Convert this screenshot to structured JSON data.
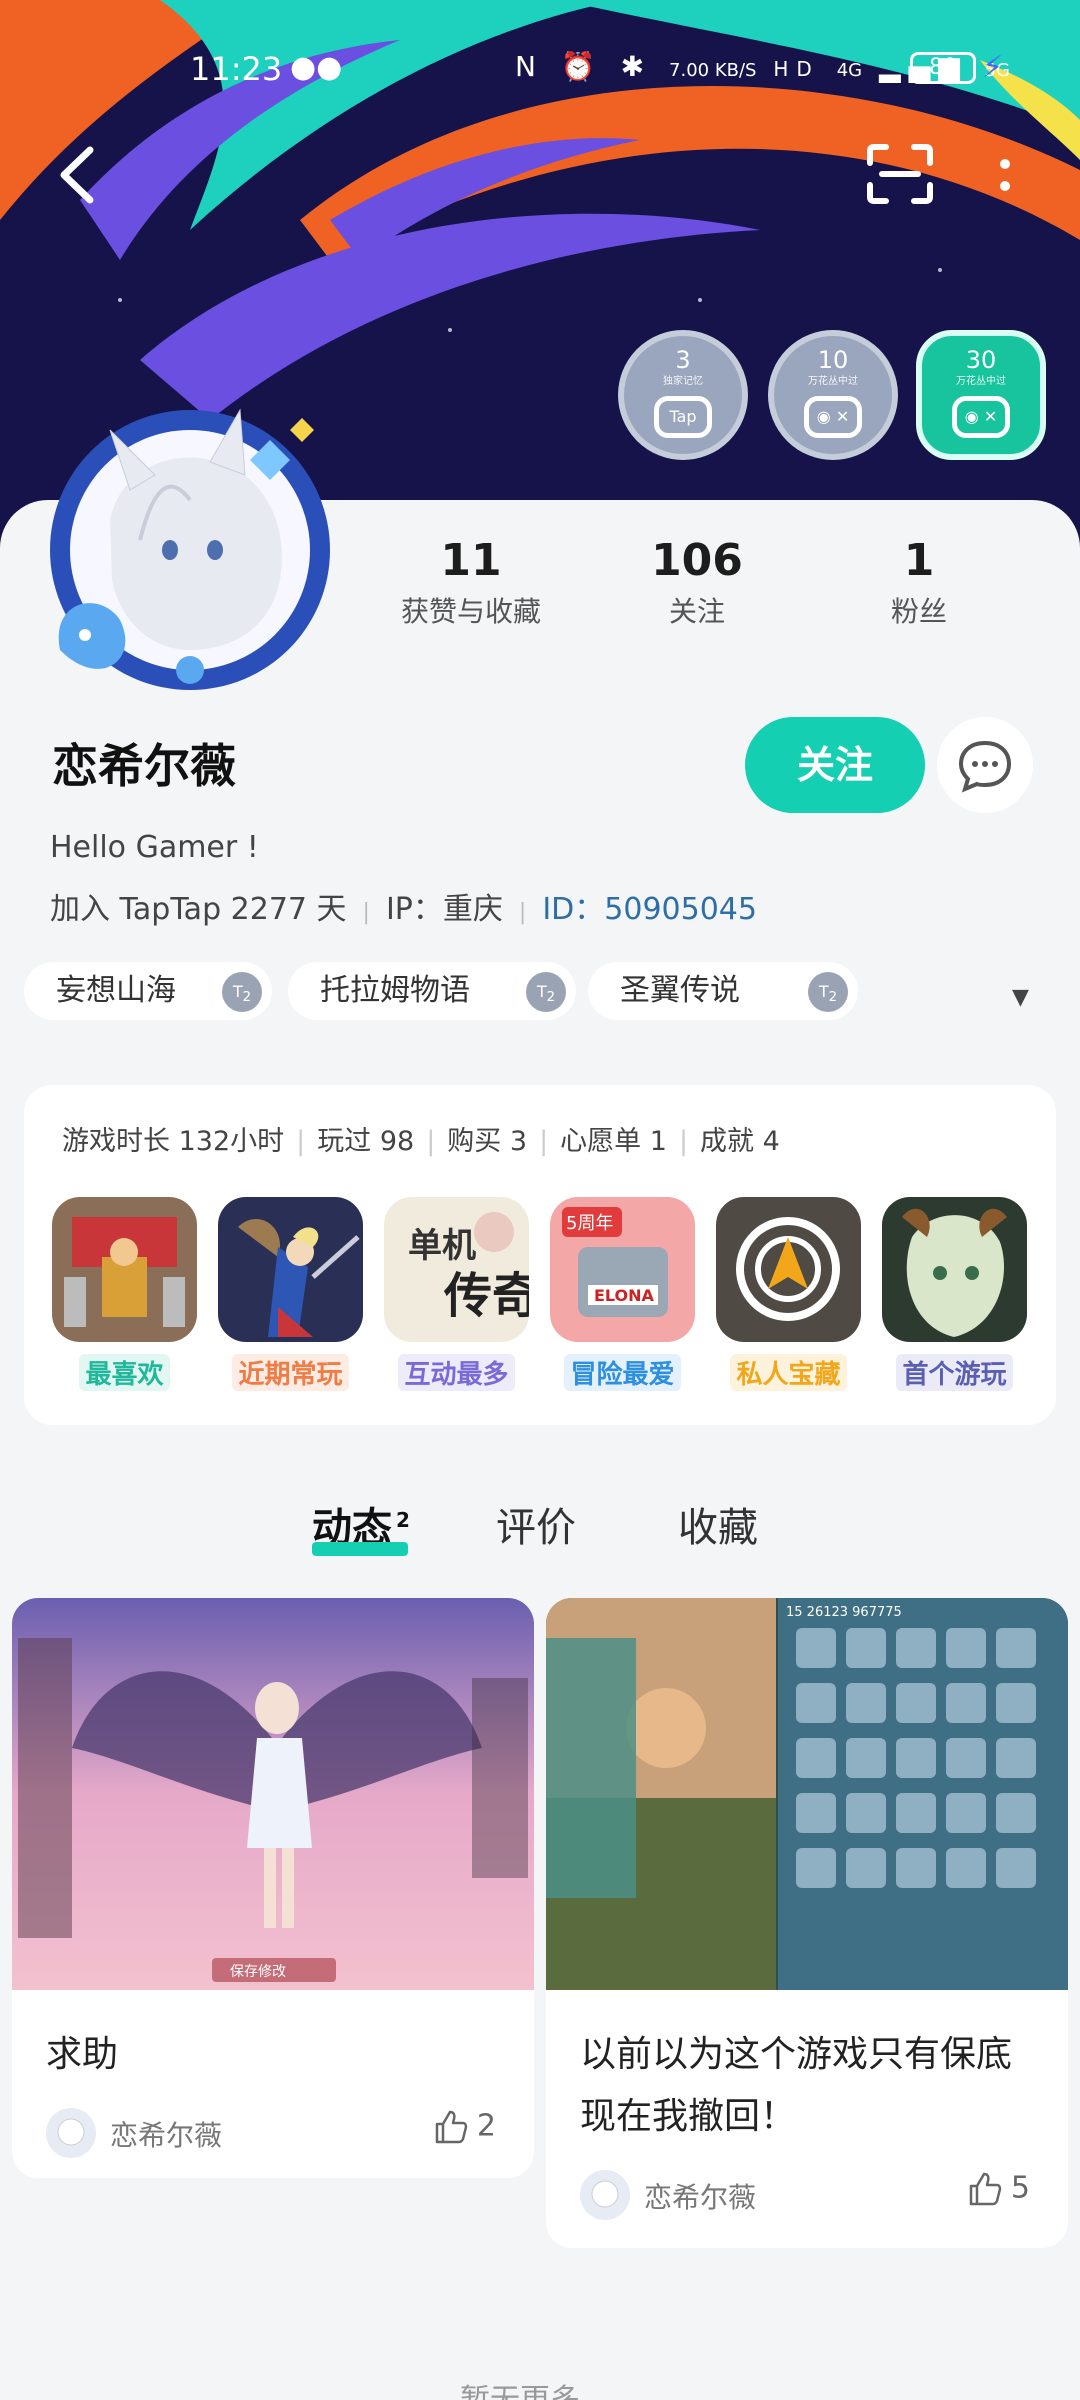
{
  "status_bar": {
    "time": "11:23",
    "net_speed": "7.00 KB/S",
    "signal_labels": [
      "4G",
      "5G"
    ],
    "hd": "HD",
    "battery": "80"
  },
  "badges": [
    {
      "num": "3",
      "caption": "独家记忆",
      "glyph": "Tap"
    },
    {
      "num": "10",
      "caption": "万花丛中过",
      "glyph": ""
    },
    {
      "num": "30",
      "caption": "万花丛中过",
      "glyph": ""
    }
  ],
  "stats": [
    {
      "value": "11",
      "label": "获赞与收藏"
    },
    {
      "value": "106",
      "label": "关注"
    },
    {
      "value": "1",
      "label": "粉丝"
    }
  ],
  "profile": {
    "name": "恋希尔薇",
    "follow_label": "关注",
    "bio": "Hello Gamer !",
    "joined": "加入 TapTap 2277 天",
    "ip": "IP：重庆",
    "id": "ID：50905045"
  },
  "tags": [
    {
      "name": "妄想山海",
      "level": "2"
    },
    {
      "name": "托拉姆物语",
      "level": "2"
    },
    {
      "name": "圣翼传说",
      "level": "2"
    }
  ],
  "game_stats": {
    "playtime": "游戏时长 132小时",
    "played": "玩过 98",
    "bought": "购买 3",
    "wishlist": "心愿单 1",
    "achievements": "成就 4"
  },
  "game_tiles": [
    {
      "label": "最喜欢",
      "color": "#1fb89a",
      "bg": "#e3f7f2"
    },
    {
      "label": "近期常玩",
      "color": "#f07b45",
      "bg": "#fdece3"
    },
    {
      "label": "互动最多",
      "color": "#7a6ad8",
      "bg": "#eeebfb"
    },
    {
      "label": "冒险最爱",
      "color": "#2d8fe0",
      "bg": "#e4f1fc"
    },
    {
      "label": "私人宝藏",
      "color": "#f2a71b",
      "bg": "#fdf3dd"
    },
    {
      "label": "首个游玩",
      "color": "#5b5fb3",
      "bg": "#ebebf7"
    }
  ],
  "game_tile_texts": {
    "t3a": "单机",
    "t3b": "传奇",
    "t4": "ELONA",
    "t4b": "5周年"
  },
  "tabs": [
    {
      "label": "动态",
      "count": "2"
    },
    {
      "label": "评价"
    },
    {
      "label": "收藏"
    }
  ],
  "posts": [
    {
      "title": "求助",
      "author": "恋希尔薇",
      "likes": "2",
      "img_text": "保存修改"
    },
    {
      "title": "以前以为这个游戏只有保底现在我撤回！",
      "author": "恋希尔薇",
      "likes": "5",
      "img_text": "15 26123 967775"
    }
  ],
  "footer": {
    "more": "暂无更多"
  },
  "colors": {
    "accent": "#14cfb1",
    "id_link": "#2d6ea8",
    "banner_bg": "#15134a"
  }
}
